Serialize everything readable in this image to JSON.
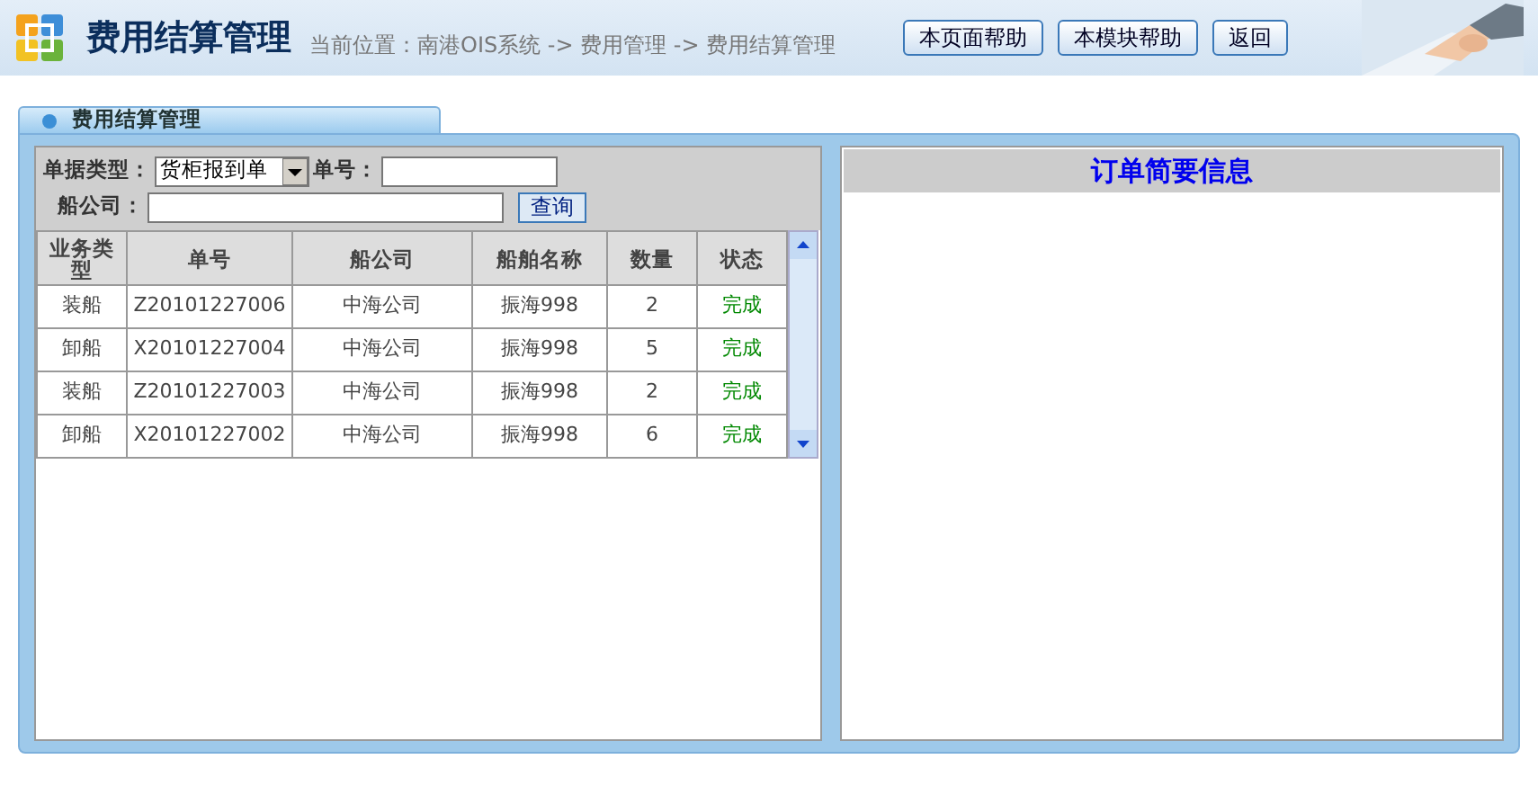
{
  "header": {
    "title": "费用结算管理",
    "breadcrumb": "当前位置：南港OIS系统 -> 费用管理 -> 费用结算管理",
    "buttons": [
      "本页面帮助",
      "本模块帮助",
      "返回"
    ]
  },
  "panel": {
    "tab": "费用结算管理"
  },
  "filters": {
    "doc_type_label": "单据类型：",
    "doc_type_value": "货柜报到单",
    "number_label": "单号：",
    "company_label": "船公司：",
    "search_button": "查询"
  },
  "table": {
    "columns": [
      "业务类型",
      "单号",
      "船公司",
      "船舶名称",
      "数量",
      "状态"
    ],
    "rows": [
      {
        "cells": [
          "装船",
          "Z20101227006",
          "中海公司",
          "振海998",
          "2",
          "完成"
        ]
      },
      {
        "cells": [
          "卸船",
          "X20101227004",
          "中海公司",
          "振海998",
          "5",
          "完成"
        ]
      },
      {
        "cells": [
          "装船",
          "Z20101227003",
          "中海公司",
          "振海998",
          "2",
          "完成"
        ]
      },
      {
        "cells": [
          "卸船",
          "X20101227002",
          "中海公司",
          "振海998",
          "6",
          "完成"
        ]
      }
    ]
  },
  "detail": {
    "title": "订单简要信息"
  }
}
